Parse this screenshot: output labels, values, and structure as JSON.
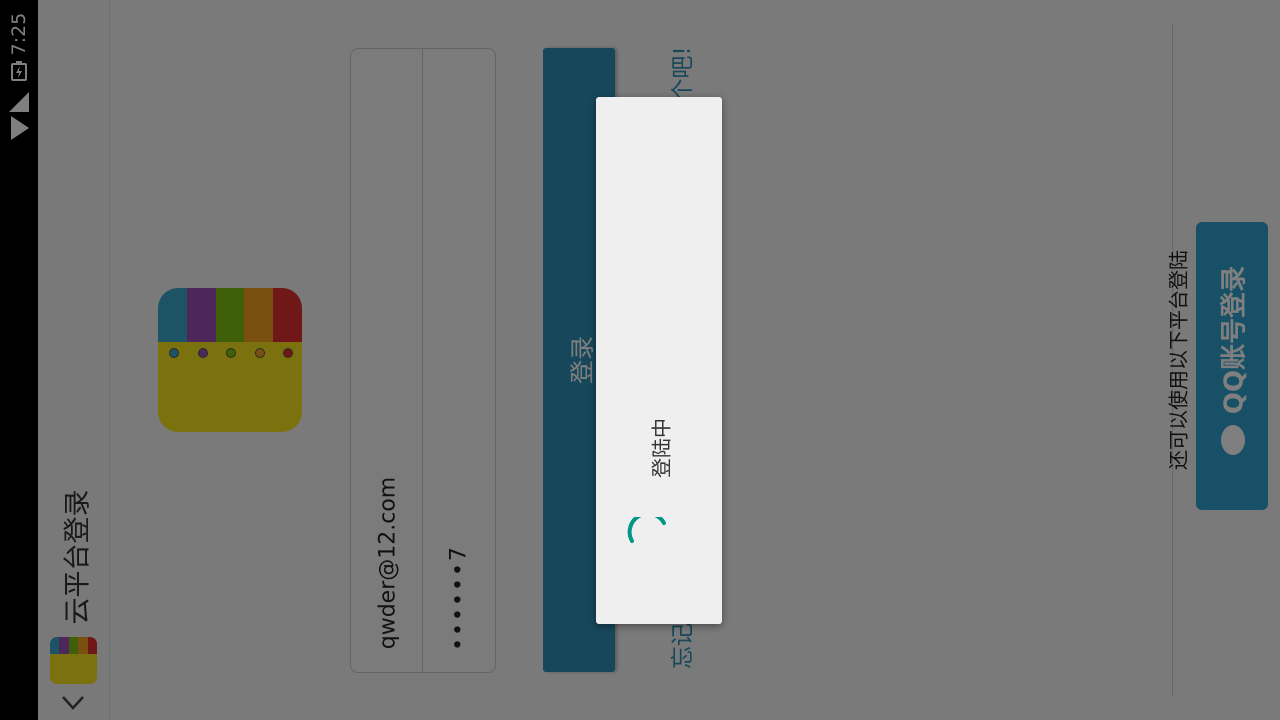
{
  "status_bar": {
    "time": "7:25"
  },
  "app_bar": {
    "title": "云平台登录"
  },
  "form": {
    "email_value": "qwder@12.com",
    "password_value": "••••••7",
    "login_label": "登录",
    "forgot_partial": "忘记",
    "register_partial": "个吧!"
  },
  "social": {
    "hint": "还可以使用以下平台登陆",
    "qq_label": "QQ账号登录"
  },
  "dialog": {
    "message": "登陆中"
  },
  "colors": {
    "accent": "#2e8fb6",
    "qq": "#2ea0cf",
    "spinner": "#009688"
  }
}
